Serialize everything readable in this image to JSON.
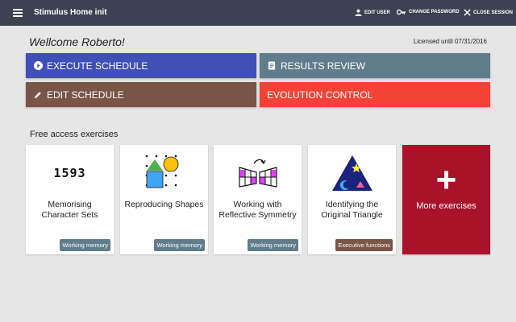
{
  "header": {
    "title": "Stimulus Home init",
    "actions": {
      "edit_user": "EDIT USER",
      "change_password": "CHANGE PASSWORD",
      "close_session": "CLOSE SESSION"
    },
    "icons": [
      "menu-icon",
      "person-icon",
      "key-icon",
      "close-icon"
    ]
  },
  "welcome": {
    "greeting": "Wellcome Roberto!",
    "license": "Licensed until 07/31/2016"
  },
  "actions": {
    "execute_schedule": "EXECUTE SCHEDULE",
    "results_review": "RESULTS REVIEW",
    "edit_schedule": "EDIT SCHEDULE",
    "evolution_control": "EVOLUTION CONTROL"
  },
  "colors": {
    "execute": "#3f51b5",
    "results": "#607d8b",
    "edit": "#795548",
    "evolution": "#f44336",
    "more": "#a8132a"
  },
  "exercises": {
    "section_title": "Free access exercises",
    "items": [
      {
        "title": "Memorising Character Sets",
        "tag": "Working memory",
        "image_text": "1593"
      },
      {
        "title": "Reproducing Shapes",
        "tag": "Working memory"
      },
      {
        "title": "Working with Reflective Symmetry",
        "tag": "Working memory"
      },
      {
        "title": "Identifying the Original Triangle",
        "tag": "Executive functions"
      }
    ],
    "more": {
      "symbol": "+",
      "label": "More exercises"
    }
  }
}
